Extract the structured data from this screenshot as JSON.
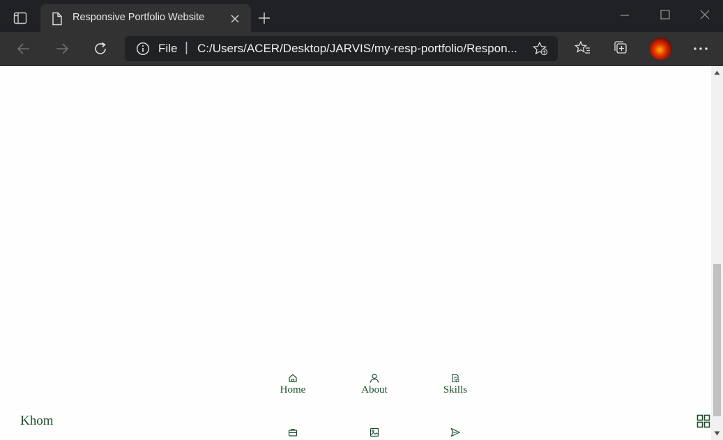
{
  "browser": {
    "tab_title": "Responsive Portfolio Website",
    "address_scheme": "File",
    "address_separator": "|",
    "address_url": "C:/Users/ACER/Desktop/JARVIS/my-resp-portfolio/Respon..."
  },
  "site": {
    "logo": "Khom",
    "nav": [
      {
        "label": "Home",
        "icon": "home-icon"
      },
      {
        "label": "About",
        "icon": "user-icon"
      },
      {
        "label": "Skills",
        "icon": "file-icon"
      },
      {
        "label": "",
        "icon": "briefcase-icon"
      },
      {
        "label": "",
        "icon": "image-icon"
      },
      {
        "label": "",
        "icon": "send-icon"
      }
    ],
    "menu_toggle_icon": "grid-icon"
  },
  "colors": {
    "accent": "#1c4d2a",
    "page_bg": "#fdfefd",
    "browser_dark": "#202124",
    "toolbar": "#323233"
  }
}
